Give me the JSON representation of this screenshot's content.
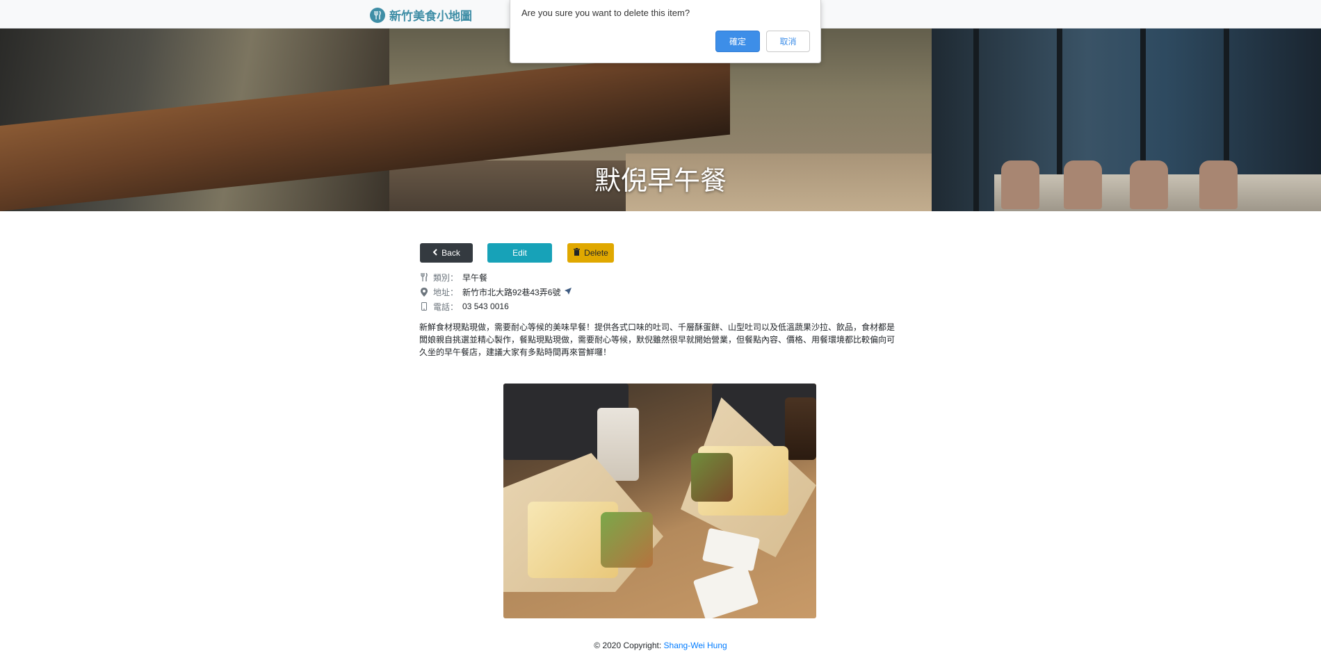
{
  "navbar": {
    "brand_text": "新竹美食小地圖",
    "brand_icon": "utensils-icon"
  },
  "hero": {
    "title": "默倪早午餐"
  },
  "actions": {
    "back_label": "Back",
    "edit_label": "Edit",
    "delete_label": "Delete"
  },
  "details": {
    "category_label": "類別：",
    "category_value": "早午餐",
    "address_label": "地址：",
    "address_value": "新竹市北大路92巷43弄6號",
    "phone_label": "電話：",
    "phone_value": "03 543 0016",
    "description": "新鮮食材現點現做，需要耐心等候的美味早餐！提供各式口味的吐司、千層酥蛋餅、山型吐司以及低溫蔬果沙拉、飲品，食材都是闆娘親自挑選並精心製作，餐點現點現做，需要耐心等候，默倪雖然很早就開始營業，但餐點內容、價格、用餐環境都比較偏向可久坐的早午餐店，建議大家有多點時間再來嘗鮮囉！"
  },
  "footer": {
    "copyright": "© 2020 Copyright:",
    "author": "Shang-Wei Hung"
  },
  "dialog": {
    "message": "Are you sure you want to delete this item?",
    "ok_label": "確定",
    "cancel_label": "取消"
  },
  "colors": {
    "brand": "#3f8ea6",
    "back_button": "#343a40",
    "edit_button": "#17a2b8",
    "delete_button": "#e0a800",
    "dialog_ok": "#3d8ee8",
    "link": "#007bff"
  }
}
